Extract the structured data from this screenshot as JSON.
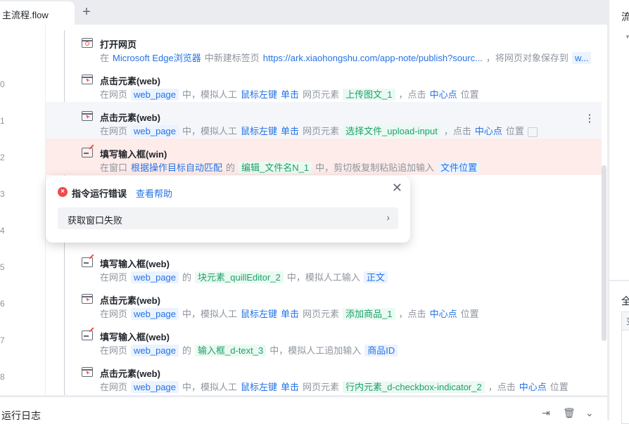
{
  "tabs": {
    "active": "主流程.flow",
    "add": "+"
  },
  "line_numbers": [
    "0",
    "1",
    "2",
    "3",
    "4",
    "5",
    "6",
    "7",
    "8"
  ],
  "rows": [
    {
      "icon": "web",
      "title": "打开网页",
      "desc": [
        {
          "t": "在",
          "k": "p"
        },
        {
          "t": "Microsoft Edge浏览器",
          "k": "link"
        },
        {
          "t": "中新建标签页",
          "k": "p"
        },
        {
          "t": "https://ark.xiaohongshu.com/app-note/publish?sourc...",
          "k": "link"
        },
        {
          "t": "，将网页对象保存到",
          "k": "p"
        },
        {
          "t": "w...",
          "k": "tb"
        }
      ]
    },
    {
      "icon": "click",
      "title": "点击元素(web)",
      "desc": [
        {
          "t": "在网页",
          "k": "p"
        },
        {
          "t": "web_page",
          "k": "tb"
        },
        {
          "t": "中，模拟人工",
          "k": "p"
        },
        {
          "t": "鼠标左键",
          "k": "link"
        },
        {
          "t": "单击",
          "k": "link"
        },
        {
          "t": "网页元素",
          "k": "p"
        },
        {
          "t": "上传图文_1",
          "k": "tg"
        },
        {
          "t": "，点击",
          "k": "p"
        },
        {
          "t": "中心点",
          "k": "link"
        },
        {
          "t": "位置",
          "k": "p"
        }
      ]
    },
    {
      "icon": "click",
      "title": "点击元素(web)",
      "state": "sel",
      "desc": [
        {
          "t": "在网页",
          "k": "p"
        },
        {
          "t": "web_page",
          "k": "tb"
        },
        {
          "t": "中，模拟人工",
          "k": "p"
        },
        {
          "t": "鼠标左键",
          "k": "link"
        },
        {
          "t": "单击",
          "k": "link"
        },
        {
          "t": "网页元素",
          "k": "p"
        },
        {
          "t": "选择文件_upload-input",
          "k": "tg"
        },
        {
          "t": "，点击",
          "k": "p"
        },
        {
          "t": "中心点",
          "k": "link"
        },
        {
          "t": "位置",
          "k": "p"
        }
      ]
    },
    {
      "icon": "input",
      "title": "填写输入框(win)",
      "state": "err",
      "desc": [
        {
          "t": "在窗口",
          "k": "p"
        },
        {
          "t": "根据操作目标自动匹配",
          "k": "link"
        },
        {
          "t": "的",
          "k": "p"
        },
        {
          "t": "编辑_文件名N_1",
          "k": "tg"
        },
        {
          "t": "中，剪切板复制粘贴追加输入",
          "k": "p"
        },
        {
          "t": "文件位置",
          "k": "tb"
        }
      ]
    },
    {
      "icon": "none",
      "title": "",
      "desc": []
    },
    {
      "icon": "none",
      "title": "",
      "desc": []
    },
    {
      "icon": "input",
      "title": "填写输入框(web)",
      "desc": [
        {
          "t": "在网页",
          "k": "p"
        },
        {
          "t": "web_page",
          "k": "tb"
        },
        {
          "t": "的",
          "k": "p"
        },
        {
          "t": "块元素_quillEditor_2",
          "k": "tg"
        },
        {
          "t": "中，模拟人工输入",
          "k": "p"
        },
        {
          "t": "正文",
          "k": "tb"
        }
      ]
    },
    {
      "icon": "click",
      "title": "点击元素(web)",
      "desc": [
        {
          "t": "在网页",
          "k": "p"
        },
        {
          "t": "web_page",
          "k": "tb"
        },
        {
          "t": "中，模拟人工",
          "k": "p"
        },
        {
          "t": "鼠标左键",
          "k": "link"
        },
        {
          "t": "单击",
          "k": "link"
        },
        {
          "t": "网页元素",
          "k": "p"
        },
        {
          "t": "添加商品_1",
          "k": "tg"
        },
        {
          "t": "，点击",
          "k": "p"
        },
        {
          "t": "中心点",
          "k": "link"
        },
        {
          "t": "位置",
          "k": "p"
        }
      ]
    },
    {
      "icon": "input",
      "title": "填写输入框(web)",
      "desc": [
        {
          "t": "在网页",
          "k": "p"
        },
        {
          "t": "web_page",
          "k": "tb"
        },
        {
          "t": "的",
          "k": "p"
        },
        {
          "t": "输入框_d-text_3",
          "k": "tg"
        },
        {
          "t": "中，模拟人工追加输入",
          "k": "p"
        },
        {
          "t": "商品ID",
          "k": "tb"
        }
      ]
    },
    {
      "icon": "click",
      "title": "点击元素(web)",
      "desc": [
        {
          "t": "在网页",
          "k": "p"
        },
        {
          "t": "web_page",
          "k": "tb"
        },
        {
          "t": "中，模拟人工",
          "k": "p"
        },
        {
          "t": "鼠标左键",
          "k": "link"
        },
        {
          "t": "单击",
          "k": "link"
        },
        {
          "t": "网页元素",
          "k": "p"
        },
        {
          "t": "行内元素_d-checkbox-indicator_2",
          "k": "tg"
        },
        {
          "t": "，点击",
          "k": "p"
        },
        {
          "t": "中心点",
          "k": "link"
        },
        {
          "t": "位置",
          "k": "p"
        }
      ]
    }
  ],
  "error_popup": {
    "title": "指令运行错误",
    "help_link": "查看帮助",
    "detail": "获取窗口失败"
  },
  "bottom_panel": {
    "title": "运行日志"
  },
  "right_panel": {
    "title_partial": "流",
    "section_partial": "全",
    "column_partial": "变"
  },
  "colors": {
    "accent": "#2473e6",
    "error": "#f04a4a",
    "error_row": "#fdecea",
    "tag_green": "#1f9f6b"
  }
}
